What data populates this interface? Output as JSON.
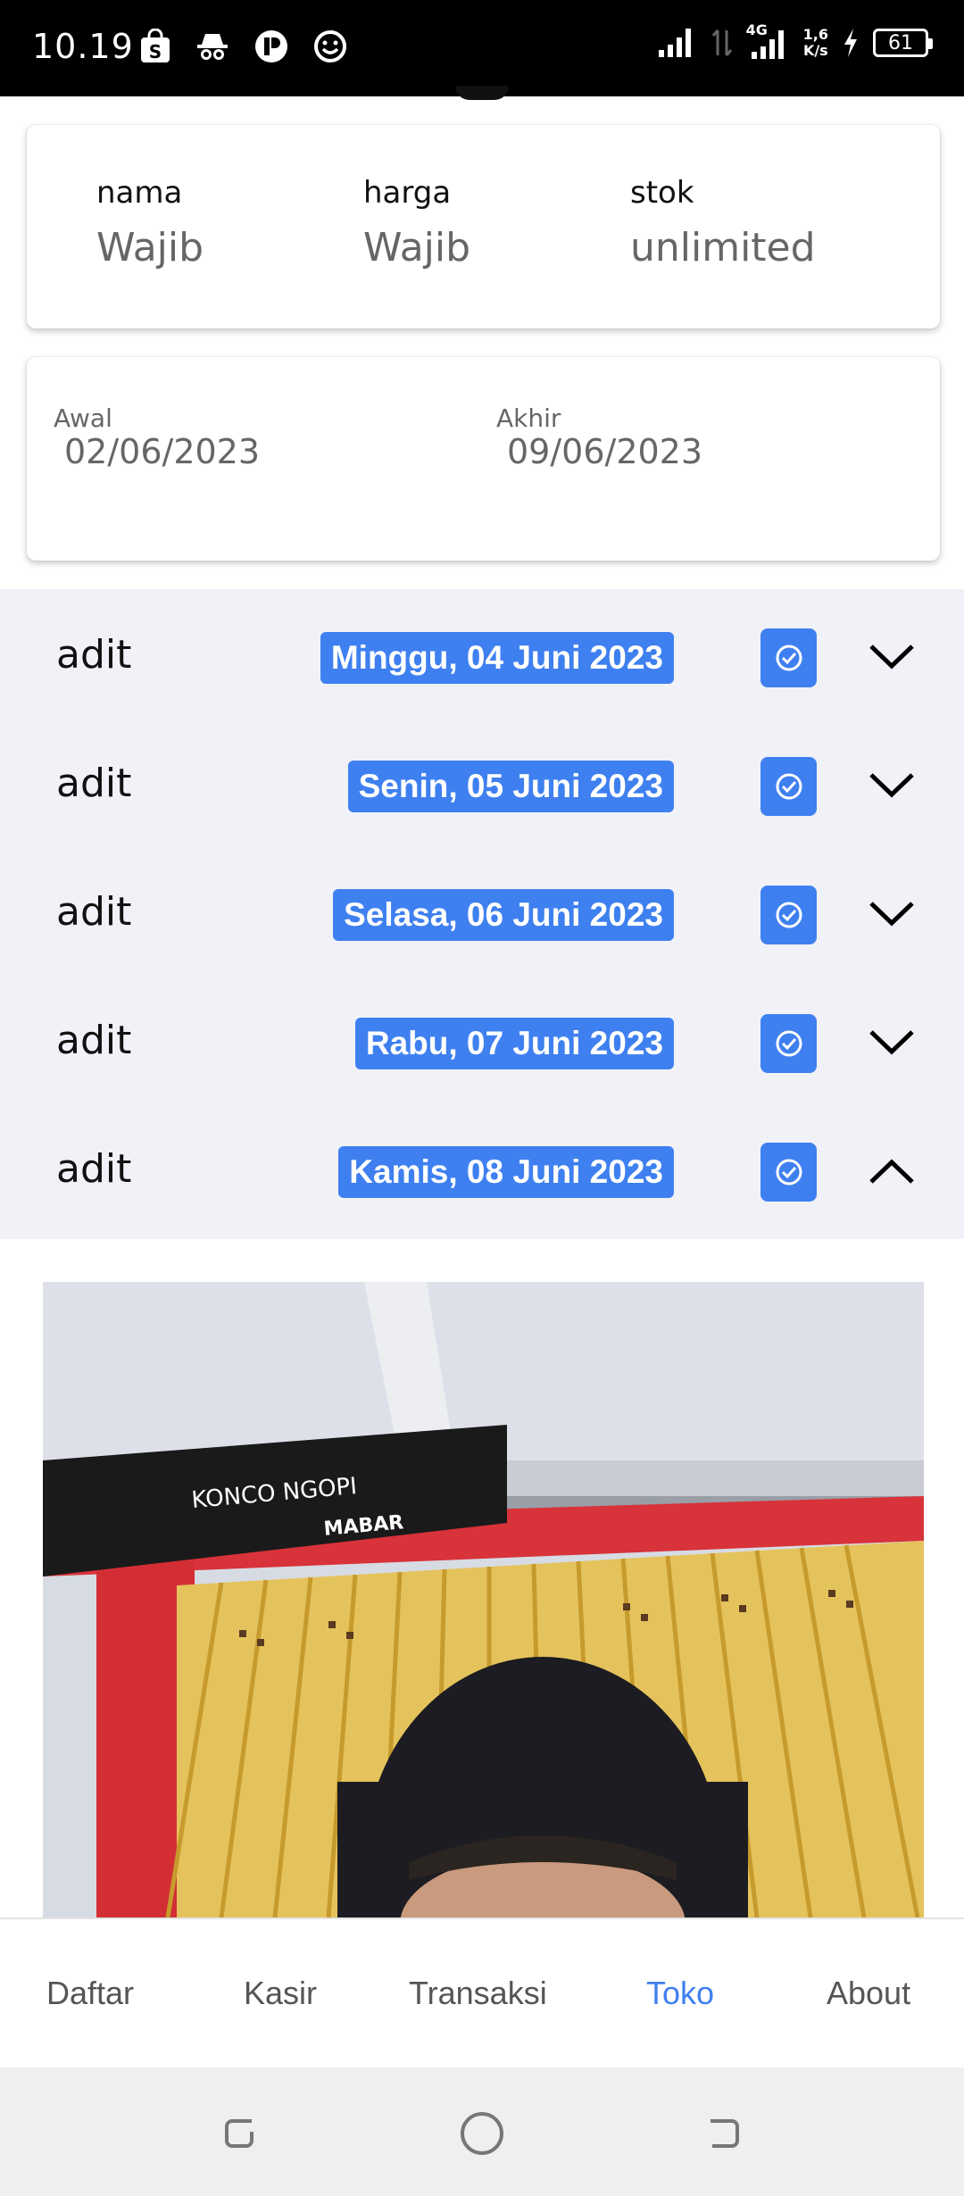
{
  "status_bar": {
    "time": "10.19",
    "network_type": "4G",
    "speed": "1,6",
    "speed_unit": "K/s",
    "battery": "61"
  },
  "product_card": {
    "name_label": "nama",
    "name_value": "Wajib",
    "price_label": "harga",
    "price_value": "Wajib",
    "stock_label": "stok",
    "stock_value": "unlimited"
  },
  "date_range": {
    "start_label": "Awal",
    "start_value": "02/06/2023",
    "end_label": "Akhir",
    "end_value": "09/06/2023"
  },
  "entries": [
    {
      "name": "adit",
      "date": "Minggu, 04 Juni 2023",
      "expanded": false
    },
    {
      "name": "adit",
      "date": "Senin, 05 Juni 2023",
      "expanded": false
    },
    {
      "name": "adit",
      "date": "Selasa, 06 Juni 2023",
      "expanded": false
    },
    {
      "name": "adit",
      "date": "Rabu, 07 Juni 2023",
      "expanded": false
    },
    {
      "name": "adit",
      "date": "Kamis, 08 Juni 2023",
      "expanded": true
    }
  ],
  "photo_banner": {
    "banner_text": "KONCO NGOPI",
    "banner_sub": "MABAR"
  },
  "bottom_nav": {
    "items": [
      "Daftar",
      "Kasir",
      "Transaksi",
      "Toko",
      "About"
    ],
    "active": "Toko"
  },
  "colors": {
    "accent": "#3f80f0",
    "list_background": "#f1f2f7"
  }
}
